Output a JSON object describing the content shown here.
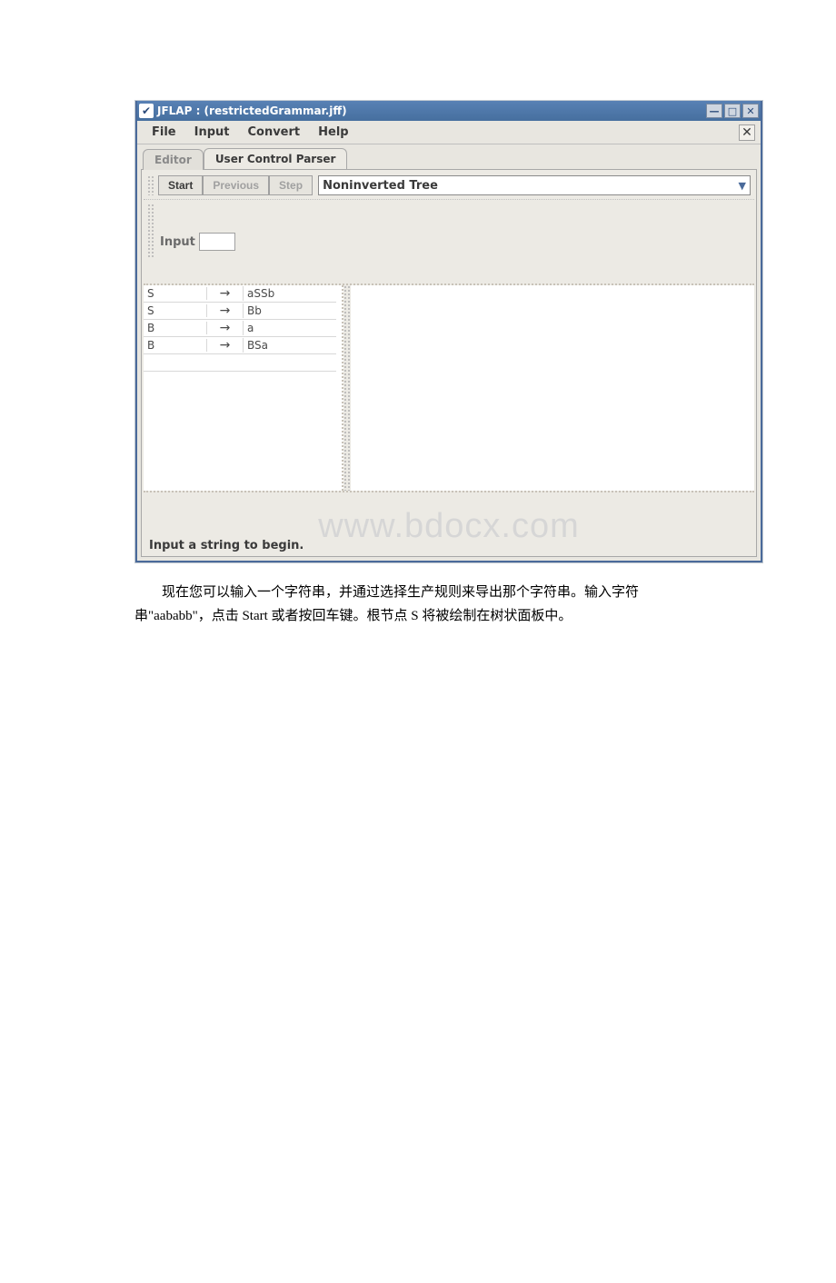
{
  "titlebar": {
    "title": "JFLAP : (restrictedGrammar.jff)"
  },
  "menubar": {
    "items": [
      "File",
      "Input",
      "Convert",
      "Help"
    ]
  },
  "tabs": {
    "editor": "Editor",
    "parser": "User Control Parser"
  },
  "toolbar": {
    "start": "Start",
    "previous": "Previous",
    "step": "Step",
    "select_value": "Noninverted Tree"
  },
  "input": {
    "label": "Input"
  },
  "grammar": {
    "arrow": "→",
    "rules": [
      {
        "lhs": "S",
        "rhs": "aSSb"
      },
      {
        "lhs": "S",
        "rhs": "Bb"
      },
      {
        "lhs": "B",
        "rhs": "a"
      },
      {
        "lhs": "B",
        "rhs": "BSa"
      }
    ]
  },
  "watermark": "www.bdocx.com",
  "status": "Input a string to begin.",
  "description": {
    "line1": "现在您可以输入一个字符串，并通过选择生产规则来导出那个字符串。输入字符",
    "line2": "串\"aababb\"，点击 Start 或者按回车键。根节点 S 将被绘制在树状面板中。"
  }
}
